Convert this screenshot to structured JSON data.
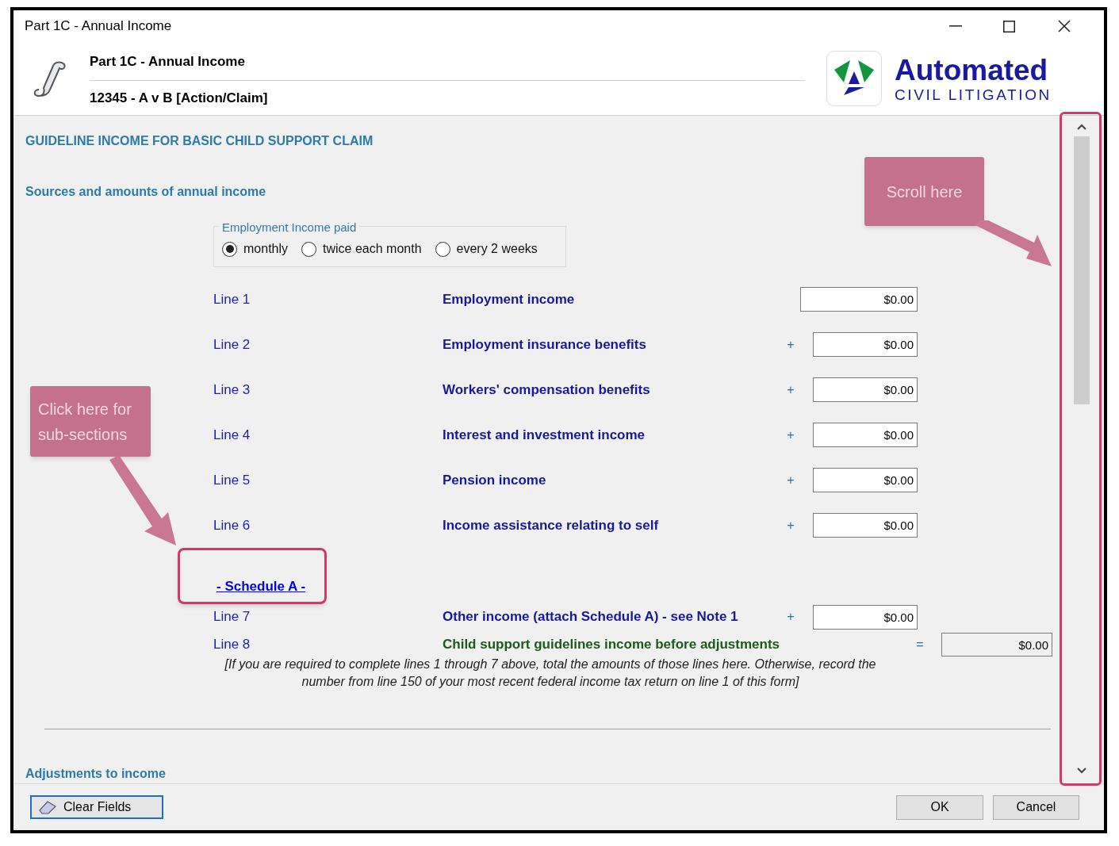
{
  "window": {
    "title": "Part 1C - Annual Income"
  },
  "header": {
    "title": "Part 1C - Annual Income",
    "subtitle": "12345 - A v B [Action/Claim]",
    "logo": {
      "name": "Automated",
      "tagline": "CIVIL LITIGATION"
    }
  },
  "heading": "GUIDELINE INCOME FOR BASIC CHILD SUPPORT CLAIM",
  "section": "Sources and amounts of annual income",
  "pay_period": {
    "legend": "Employment Income paid",
    "options": [
      {
        "label": "monthly",
        "selected": true
      },
      {
        "label": "twice each month",
        "selected": false
      },
      {
        "label": "every 2 weeks",
        "selected": false
      }
    ]
  },
  "lines": [
    {
      "label": "Line 1",
      "description": "Employment income",
      "value": "$0.00"
    },
    {
      "label": "Line 2",
      "description": "Employment insurance benefits",
      "operator": "+",
      "value": "$0.00"
    },
    {
      "label": "Line 3",
      "description": "Workers' compensation benefits",
      "operator": "+",
      "value": "$0.00"
    },
    {
      "label": "Line 4",
      "description": "Interest and investment income",
      "operator": "+",
      "value": "$0.00"
    },
    {
      "label": "Line 5",
      "description": "Pension income",
      "operator": "+",
      "value": "$0.00"
    },
    {
      "label": "Line 6",
      "description": "Income assistance relating to self",
      "operator": "+",
      "value": "$0.00"
    }
  ],
  "schedule_link": "- Schedule A -",
  "line_7": {
    "label": "Line 7",
    "description": "Other income (attach Schedule A) - see Note 1",
    "operator": "+",
    "value": "$0.00"
  },
  "line_8": {
    "label": "Line 8",
    "description": "Child support guidelines income before adjustments",
    "operator": "=",
    "value": "$0.00",
    "note": "[If you are required to complete lines 1 through 7 above, total the amounts of those lines here. Otherwise, record the number from line 150 of your most recent federal income tax return on line 1 of this form]"
  },
  "next_section": "Adjustments to income",
  "buttons": {
    "clear": "Clear Fields",
    "ok": "OK",
    "cancel": "Cancel"
  },
  "callouts": [
    "Scroll here",
    "Click here for sub-sections"
  ]
}
